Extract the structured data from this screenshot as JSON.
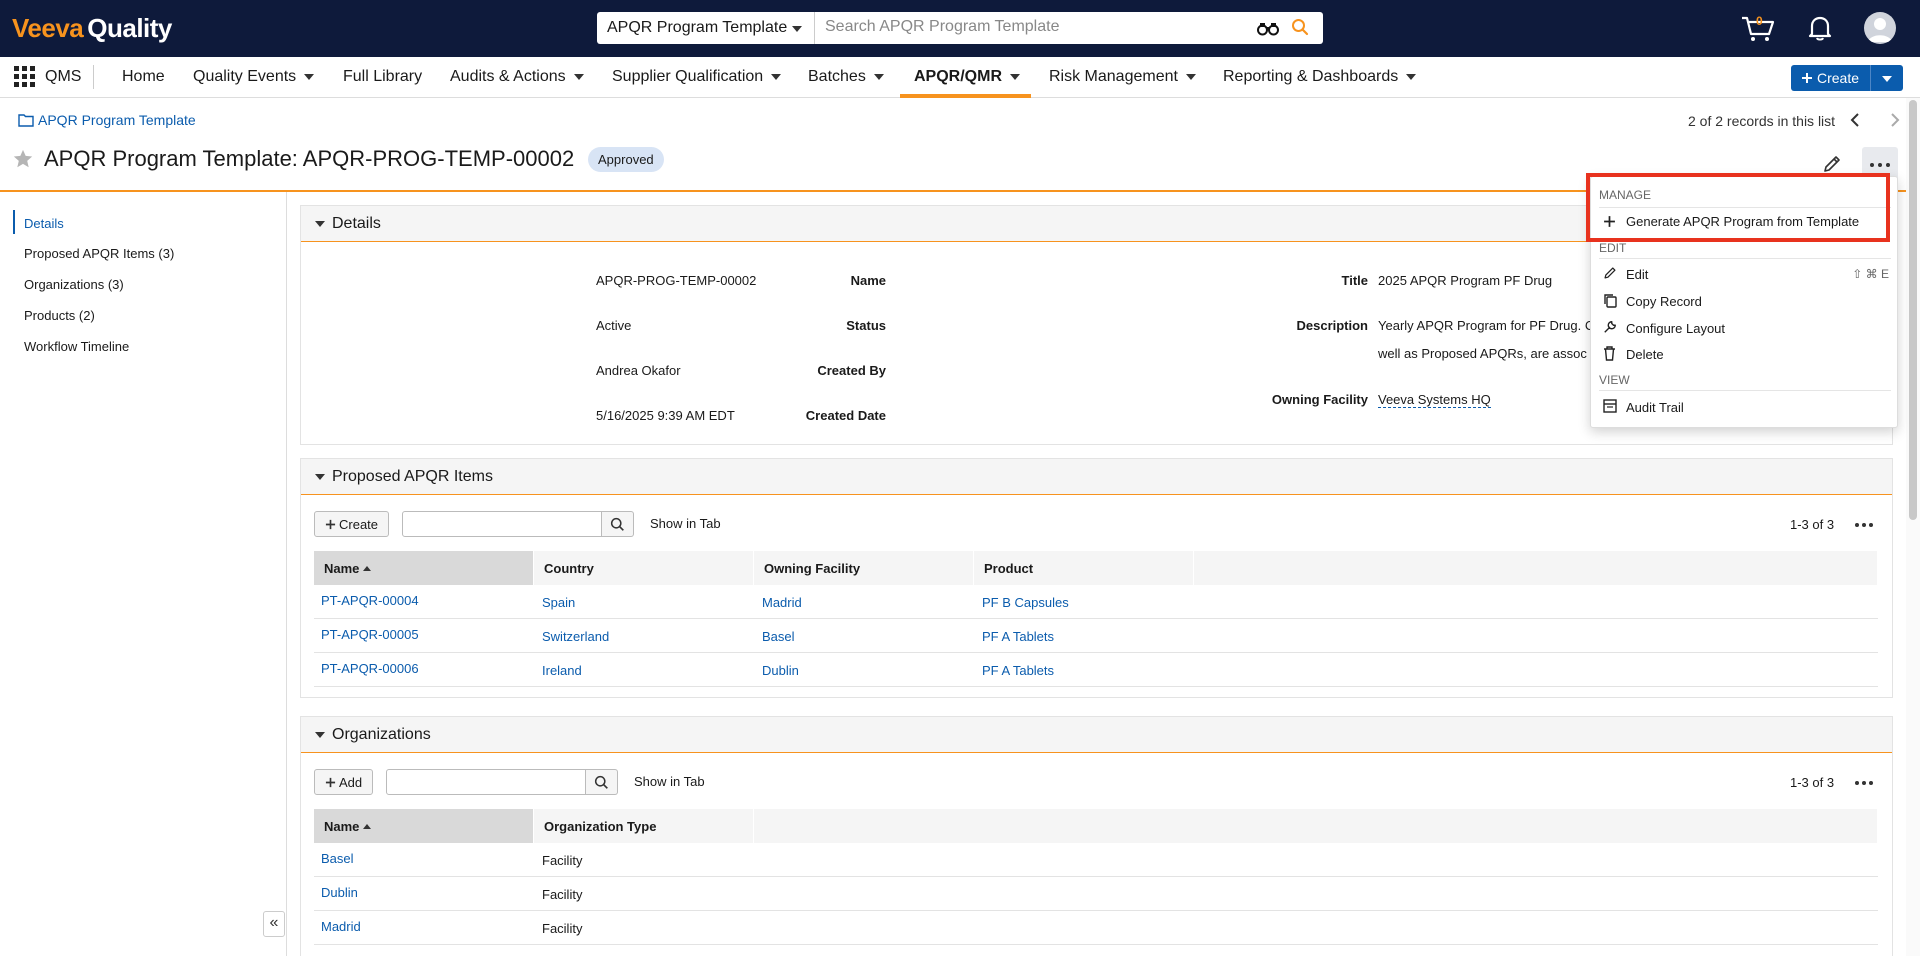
{
  "topbar": {
    "logo_brand": "Veeva",
    "logo_product": "Quality",
    "object_select": "APQR Program Template",
    "search_placeholder": "Search APQR Program Template",
    "cart_count": "0"
  },
  "nav": {
    "app": "QMS",
    "items": [
      {
        "label": "Home"
      },
      {
        "label": "Quality Events"
      },
      {
        "label": "Full Library"
      },
      {
        "label": "Audits & Actions"
      },
      {
        "label": "Supplier Qualification"
      },
      {
        "label": "Batches"
      },
      {
        "label": "APQR/QMR"
      },
      {
        "label": "Risk Management"
      },
      {
        "label": "Reporting & Dashboards"
      }
    ],
    "create_label": "Create"
  },
  "record": {
    "breadcrumb": "APQR Program Template",
    "pager": "2 of 2 records in this list",
    "title": "APQR Program Template: APQR-PROG-TEMP-00002",
    "status_badge": "Approved"
  },
  "leftnav": {
    "items": [
      {
        "label": "Details"
      },
      {
        "label": "Proposed APQR Items (3)"
      },
      {
        "label": "Organizations (3)"
      },
      {
        "label": "Products (2)"
      },
      {
        "label": "Workflow Timeline"
      }
    ],
    "collapse": "«"
  },
  "details": {
    "section_title": "Details",
    "fields_left": [
      {
        "label": "Name",
        "value": "APQR-PROG-TEMP-00002"
      },
      {
        "label": "Status",
        "value": "Active"
      },
      {
        "label": "Created By",
        "value": "Andrea Okafor"
      },
      {
        "label": "Created Date",
        "value": "5/16/2025 9:39 AM EDT"
      }
    ],
    "fields_right": [
      {
        "label": "Title",
        "value": "2025 APQR Program PF Drug"
      },
      {
        "label": "Description",
        "value": "Yearly APQR Program for PF Drug. C",
        "value2": "well as Proposed APQRs, are assoc"
      },
      {
        "label": "Owning Facility",
        "value": "Veeva Systems HQ"
      }
    ]
  },
  "proposed": {
    "section_title": "Proposed APQR Items",
    "create_label": "Create",
    "show_in_tab": "Show in Tab",
    "count": "1-3 of 3",
    "columns": [
      "Name",
      "Country",
      "Owning Facility",
      "Product"
    ],
    "rows": [
      [
        "PT-APQR-00004",
        "Spain",
        "Madrid",
        "PF B Capsules"
      ],
      [
        "PT-APQR-00005",
        "Switzerland",
        "Basel",
        "PF A Tablets"
      ],
      [
        "PT-APQR-00006",
        "Ireland",
        "Dublin",
        "PF A Tablets"
      ]
    ]
  },
  "organizations": {
    "section_title": "Organizations",
    "add_label": "Add",
    "show_in_tab": "Show in Tab",
    "count": "1-3 of 3",
    "columns": [
      "Name",
      "Organization Type"
    ],
    "rows": [
      [
        "Basel",
        "Facility"
      ],
      [
        "Dublin",
        "Facility"
      ],
      [
        "Madrid",
        "Facility"
      ]
    ]
  },
  "menu": {
    "groups": {
      "manage": "MANAGE",
      "edit": "EDIT",
      "view": "VIEW"
    },
    "items": {
      "generate": "Generate APQR Program from Template",
      "edit": "Edit",
      "edit_shortcut": "⇧ ⌘ E",
      "copy": "Copy Record",
      "configure": "Configure Layout",
      "delete": "Delete",
      "audit": "Audit Trail"
    }
  },
  "colors": {
    "topbar": "#0e1a3b",
    "accent_orange": "#f7931e",
    "link_blue": "#0b5cad",
    "highlight_red": "#e8321e"
  }
}
